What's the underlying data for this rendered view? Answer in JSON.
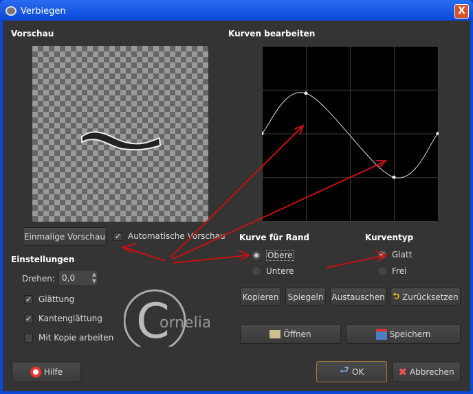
{
  "window": {
    "title": "Verbiegen",
    "close": "X"
  },
  "preview": {
    "heading": "Vorschau",
    "once_button": "Einmalige Vorschau",
    "auto_label": "Automatische Vorschau",
    "auto_checked": true
  },
  "settings": {
    "heading": "Einstellungen",
    "rotate_label": "Drehen:",
    "rotate_value": "0,0",
    "checks": [
      {
        "label": "Glättung",
        "checked": true
      },
      {
        "label": "Kantenglättung",
        "checked": true
      },
      {
        "label": "Mit Kopie arbeiten",
        "checked": false
      }
    ]
  },
  "curves": {
    "heading": "Kurven bearbeiten",
    "points": [
      [
        0,
        0.5
      ],
      [
        0.25,
        0.73
      ],
      [
        0.75,
        0.25
      ],
      [
        1,
        0.5
      ]
    ]
  },
  "border": {
    "heading": "Kurve für Rand",
    "options": [
      "Obere",
      "Untere"
    ],
    "selected": "Obere"
  },
  "curvetype": {
    "heading": "Kurventyp",
    "options": [
      "Glatt",
      "Frei"
    ],
    "selected": "Glatt"
  },
  "actions": {
    "copy": "Kopieren",
    "mirror": "Spiegeln",
    "swap": "Austauschen",
    "reset": "Zurücksetzen",
    "open": "Öffnen",
    "save": "Speichern"
  },
  "footer": {
    "help": "Hilfe",
    "ok": "OK",
    "cancel": "Abbrechen"
  },
  "watermark": "Cornelia"
}
